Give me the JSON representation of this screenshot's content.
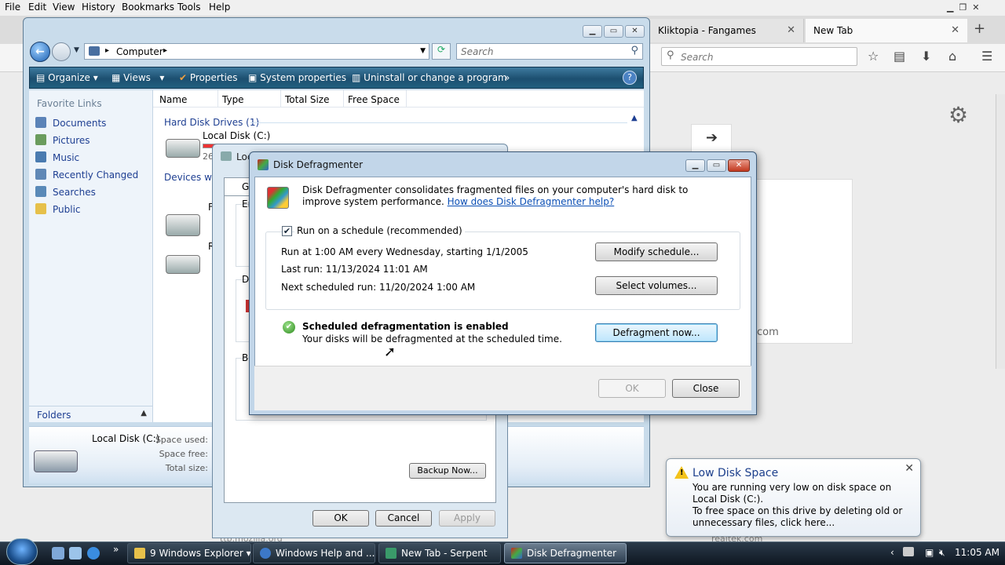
{
  "firefox": {
    "menu": [
      "File",
      "Edit",
      "View",
      "History",
      "Bookmarks",
      "Tools",
      "Help"
    ],
    "tabs": [
      {
        "label": "Kliktopia - Fangames"
      },
      {
        "label": "New Tab"
      }
    ],
    "search_placeholder": "Search",
    "thumb_caption": "com",
    "footer_left": "ttp.mozilla.org",
    "footer_right": "realtek.com"
  },
  "explorer": {
    "breadcrumb": "Computer",
    "search_placeholder": "Search",
    "commands": {
      "organize": "Organize",
      "views": "Views",
      "properties": "Properties",
      "system_properties": "System properties",
      "uninstall": "Uninstall or change a program",
      "more": "»"
    },
    "favorite_links_title": "Favorite Links",
    "favorite_links": [
      "Documents",
      "Pictures",
      "Music",
      "Recently Changed",
      "Searches",
      "Public"
    ],
    "folders_label": "Folders",
    "columns": [
      "Name",
      "Type",
      "Total Size",
      "Free Space"
    ],
    "group_hdd": "Hard Disk Drives (1)",
    "drive_c_label": "Local Disk (C:)",
    "drive_c_size_partial": "26",
    "group_devices": "Devices with",
    "device_1_partial": "Flo",
    "device_2_partial": "Re",
    "details": {
      "name": "Local Disk (C:)",
      "space_used": "Space used:",
      "space_free": "Space free:",
      "total_size": "Total size:"
    }
  },
  "properties_dialog": {
    "title_partial": "Loc",
    "tab_partial": "G",
    "group_partials": [
      "Er",
      "De",
      "Ba"
    ],
    "backup_button": "Backup Now...",
    "ok": "OK",
    "cancel": "Cancel",
    "apply": "Apply"
  },
  "defrag": {
    "title": "Disk Defragmenter",
    "intro": "Disk Defragmenter consolidates fragmented files on your computer's hard disk to improve system performance.",
    "help_link": "How does Disk Defragmenter help?",
    "schedule_checked": true,
    "schedule_label": "Run on a schedule (recommended)",
    "run_at": "Run at 1:00 AM every Wednesday, starting 1/1/2005",
    "last_run": "Last run: 11/13/2024 11:01 AM",
    "next_run": "Next scheduled run: 11/20/2024 1:00 AM",
    "modify_schedule": "Modify schedule...",
    "select_volumes": "Select volumes...",
    "status_title": "Scheduled defragmentation is enabled",
    "status_sub": "Your disks will be defragmented at the scheduled time.",
    "defragment_now": "Defragment now...",
    "ok": "OK",
    "close": "Close"
  },
  "balloon": {
    "title": "Low Disk Space",
    "message_1": "You are running very low on disk space on Local Disk (C:).",
    "message_2": "To free space on this drive by deleting old or unnecessary files, click here..."
  },
  "taskbar": {
    "items": [
      {
        "label": "9 Windows Explorer",
        "active": false
      },
      {
        "label": "Windows Help and ...",
        "active": false
      },
      {
        "label": "New Tab - Serpent",
        "active": false
      },
      {
        "label": "Disk Defragmenter",
        "active": true
      }
    ],
    "chevron": "»",
    "clock": "11:05 AM"
  }
}
